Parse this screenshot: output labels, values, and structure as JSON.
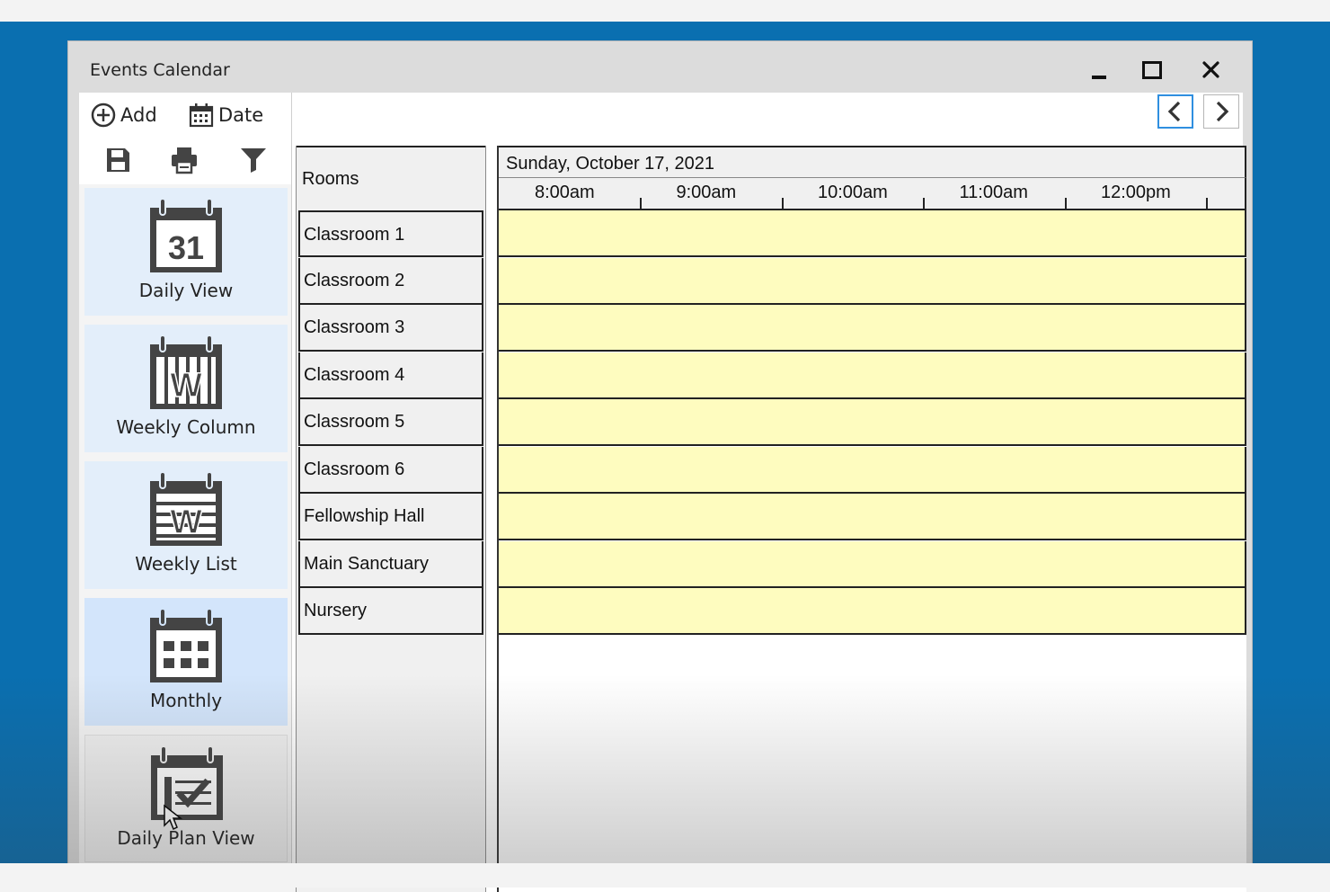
{
  "window": {
    "title": "Events Calendar"
  },
  "toolbar": {
    "add_label": "Add",
    "date_label": "Date"
  },
  "views": [
    {
      "label": "Daily View",
      "icon": "calendar-31-icon",
      "calendar_number": "31"
    },
    {
      "label": "Weekly Column",
      "icon": "calendar-weekly-column-icon",
      "calendar_letter": "W"
    },
    {
      "label": "Weekly List",
      "icon": "calendar-weekly-list-icon",
      "calendar_letter": "W"
    },
    {
      "label": "Monthly",
      "icon": "calendar-monthly-icon"
    },
    {
      "label": "Daily Plan View",
      "icon": "calendar-checklist-icon"
    }
  ],
  "selected_view": "Monthly",
  "schedule": {
    "rooms_header": "Rooms",
    "date": "Sunday, October 17, 2021",
    "times": [
      "8:00am",
      "9:00am",
      "10:00am",
      "11:00am",
      "12:00pm"
    ],
    "rooms": [
      "Classroom 1",
      "Classroom 2",
      "Classroom 3",
      "Classroom 4",
      "Classroom 5",
      "Classroom 6",
      "Fellowship Hall",
      "Main Sanctuary",
      "Nursery"
    ]
  },
  "colors": {
    "desktop": "#0a6fb0",
    "slot_fill": "#fefcbf",
    "selected_view_bg": "#d3e5fb",
    "focus_border": "#2f8fe0"
  }
}
